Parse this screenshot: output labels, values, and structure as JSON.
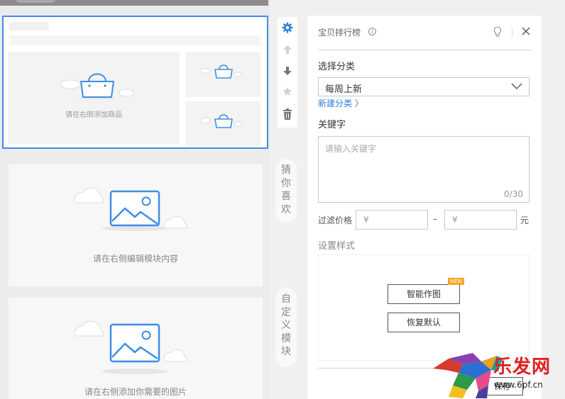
{
  "canvas": {
    "module1_caption": "请在右侧添加商品",
    "module2_caption": "请在右侧编辑模块内容",
    "module3_caption": "请在右侧添加你需要的图片"
  },
  "toolbar": {
    "icons": [
      "gear-icon",
      "arrow-up-icon",
      "arrow-down-icon",
      "star-icon",
      "trash-icon"
    ]
  },
  "side_tabs": {
    "guess_like": [
      "猜",
      "你",
      "喜",
      "欢"
    ],
    "custom_module": [
      "自",
      "定",
      "义",
      "模",
      "块"
    ]
  },
  "panel": {
    "title": "宝贝排行榜",
    "category_label": "选择分类",
    "category_value": "每周上新",
    "new_category_link": "新建分类 〉",
    "keyword_label": "关键字",
    "keyword_placeholder": "请输入关键字",
    "keyword_counter": "0/30",
    "price_label": "过滤价格",
    "price_min_placeholder": "¥",
    "price_max_placeholder": "¥",
    "price_dash": "–",
    "price_unit": "元",
    "style_label": "设置样式",
    "smart_button": "智能作图",
    "new_badge": "NEW",
    "reset_button": "恢复默认",
    "save_button": "保存"
  },
  "watermark": {
    "text": "乐发网",
    "url": "www.6pf.cn"
  },
  "colors": {
    "accent": "#3d8ee8",
    "badge": "#f5a623",
    "watermark": "#e02020"
  }
}
